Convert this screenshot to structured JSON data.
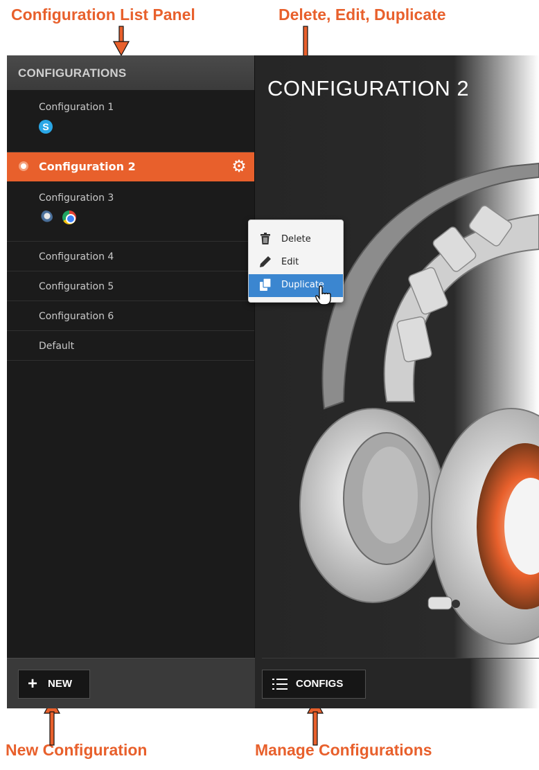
{
  "annotations": {
    "config_list": "Configuration List Panel",
    "menu_actions": "Delete, Edit, Duplicate",
    "new_config": "New Configuration",
    "manage_configs": "Manage Configurations"
  },
  "sidebar": {
    "header": "CONFIGURATIONS",
    "items": [
      {
        "label": "Configuration 1",
        "apps": [
          "skype-icon"
        ]
      },
      {
        "label": "Configuration 2",
        "active": true
      },
      {
        "label": "Configuration 3",
        "apps": [
          "steam-icon",
          "chrome-icon"
        ]
      },
      {
        "label": "Configuration 4"
      },
      {
        "label": "Configuration 5"
      },
      {
        "label": "Configuration 6"
      },
      {
        "label": "Default"
      }
    ],
    "new_button": "NEW"
  },
  "main": {
    "title": "CONFIGURATION 2",
    "configs_button": "CONFIGS"
  },
  "context_menu": {
    "items": [
      {
        "label": "Delete",
        "icon": "trash-icon"
      },
      {
        "label": "Edit",
        "icon": "pencil-icon"
      },
      {
        "label": "Duplicate",
        "icon": "duplicate-icon",
        "hover": true
      }
    ]
  },
  "colors": {
    "accent": "#e8602c",
    "menu_highlight": "#3b86d0",
    "sidebar_bg": "#1b1b1b"
  }
}
